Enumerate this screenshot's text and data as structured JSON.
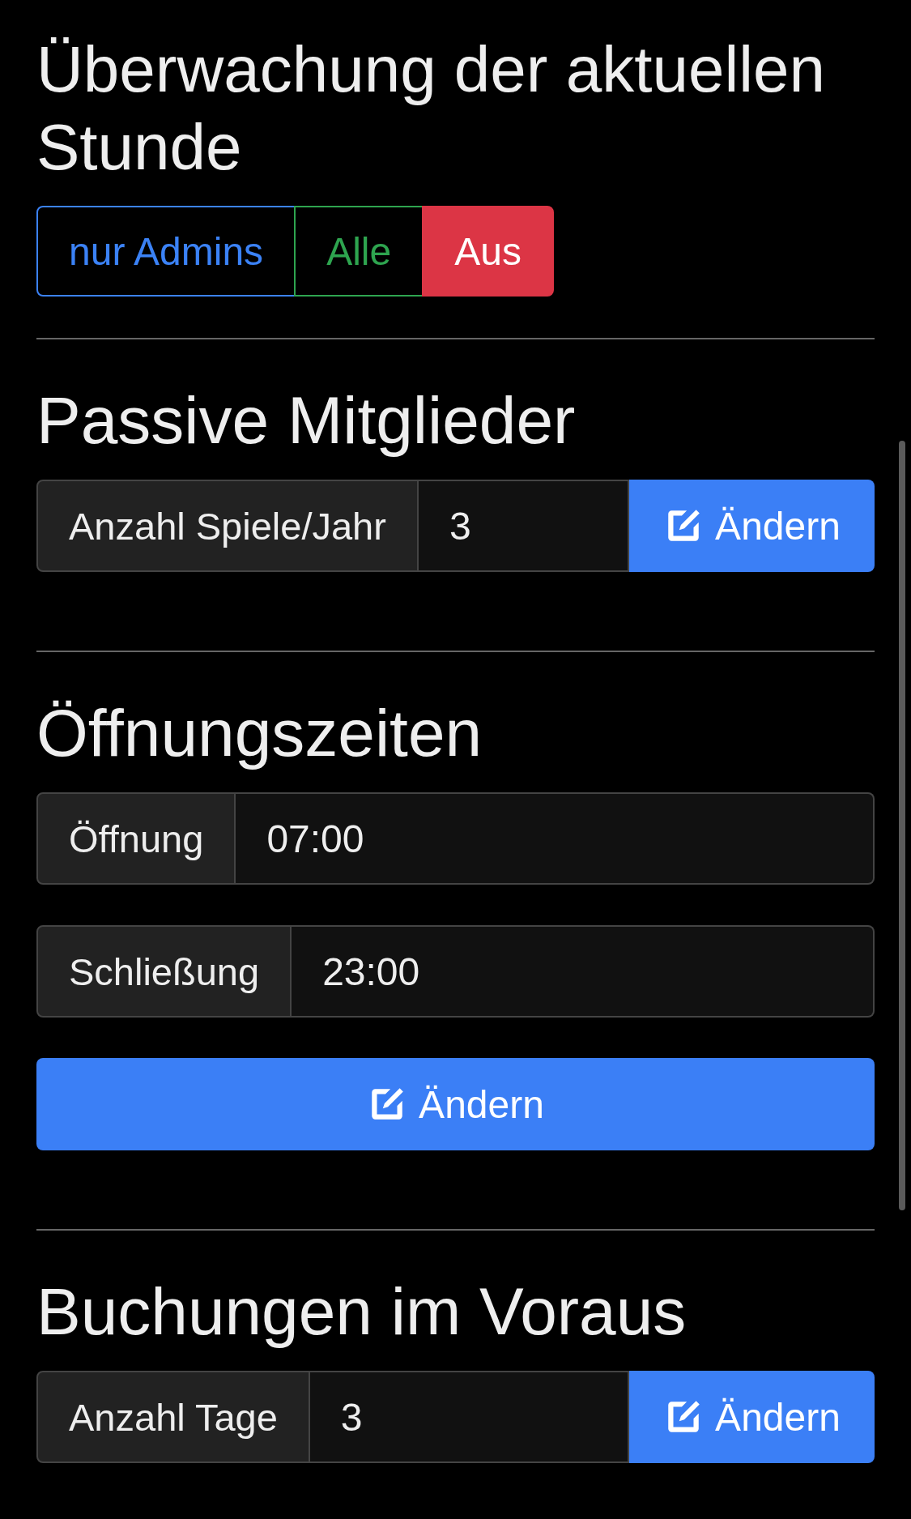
{
  "sections": [
    {
      "kind": "toggle",
      "title": "Überwachung der aktuellen Stunde",
      "options": [
        {
          "label": "nur Admins",
          "color": "#3b82f6",
          "selected": false
        },
        {
          "label": "Alle",
          "color": "#2ea44f",
          "selected": false
        },
        {
          "label": "Aus",
          "color": "#dc3545",
          "selected": true
        }
      ]
    },
    {
      "kind": "inline",
      "title": "Passive Mitglieder",
      "label": "Anzahl Spiele/Jahr",
      "value": "3",
      "button": "Ändern"
    },
    {
      "kind": "stacked",
      "title": "Öffnungszeiten",
      "fields": [
        {
          "label": "Öffnung",
          "value": "07:00"
        },
        {
          "label": "Schließung",
          "value": "23:00"
        }
      ],
      "button": "Ändern"
    },
    {
      "kind": "inline",
      "title": "Buchungen im Voraus",
      "label": "Anzahl Tage",
      "value": "3",
      "button": "Ändern"
    }
  ]
}
